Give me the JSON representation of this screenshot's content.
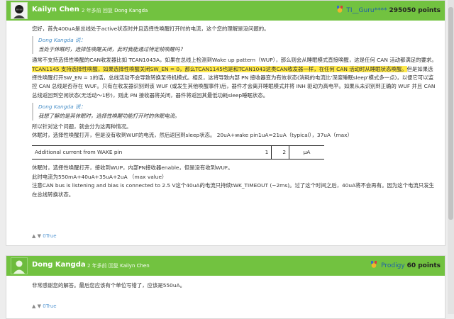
{
  "post1": {
    "author": "Kailyn Chen",
    "time": "2 年多前",
    "reply_label": "回复",
    "reply_to": "Dong Kangda",
    "rank_name": "TI__Guru****",
    "points": "295050 points",
    "lines": {
      "intro": "您好，首先400uA是总线处于active状态时并且选择性唤醒打开时的电流，这个您的理解是没问题的。",
      "q1_name": "Dong Kangda 说：",
      "q1_text": "当处于休眠时，选择性唤醒关闭，此时我能通过特定帧唤醒吗？",
      "p2a": "通常不支持选择性唤醒的CAN收发器比如 TCAN1043A，如果在总线上检测到Wake up pattern（WUP），那么则会从睡眠模式直接唤醒，这是任何 CAN 活动都满足的要求。",
      "p2b": "TCAN1145 支持选择性唤醒，如果选择性唤醒关闭SW_EN = 0，那么TCAN1145也是和TCAN1043这类CAN收发器一样，在任何 CAN 活动时从睡眠状态唤醒。",
      "p2c": "但是如果选择性唤醒打开SW_EN = 1的话，总线活动不会导致转换至待机模式。相反，这将导致内部 PN 接收器变为有效状态(消耗的电流比'深度睡眠sleep'模式多一点)，以便它可以监控 CAN 总线是否存在 WUF。只有在收发器识别到该 WUF (或发生其他唤醒事件)后，器件才会离开睡眠模式并将 INH 驱动为高电平。如果从未识别到正确的 WUF 并且 CAN 总线返回到空闲状态(无活动～1秒)，则此 PN 接收器将关闭，器件将返回其最低功耗sleep睡眠状态。",
      "q2_name": "Dong Kangda 说：",
      "q2_text": "我想了解的是其休眠时，选择性唤醒功能打开时的休眠电流。",
      "p3": "所以针对这个问题，就会分为这两种情况。",
      "p4": "休眠时，选择性唤醒打开，但是没有收到WUF的电流，然后返回到sleep状态。 20uA+wake pin1uA=21uA（typical），37uA（max）",
      "p5": "休眠时，选择性唤醒打开，接收到WUP，内部PN接收器enable，但是没有收到WUF。",
      "p6": "此时电流为550mA+40uA+35uA+2uA （max value）",
      "p7": "注意CAN bus is listening and bias is connected to 2.5 V这个40uA的电流只持续tWK_TIMEOUT (~2ms)。过了这个时间之后，40uA将不会再有。因为这个电流只发生在总线转换状态。"
    },
    "table": {
      "param": "Additional current from WAKE pin",
      "typ": "1",
      "max": "2",
      "unit": "μA"
    },
    "vote": "0True",
    "vote_arrows": "▲ ▼"
  },
  "post2": {
    "author": "Dong Kangda",
    "time": "2 年多前",
    "reply_label": "回复",
    "reply_to": "Kailyn Chen",
    "rank_name": "Prodigy",
    "points": "60 points",
    "line1": "非常感谢您的解答。最后您应该有个单位写错了，应该是550uA。",
    "vote": "0True",
    "vote_arrows": "▲ ▼"
  },
  "colors": {
    "header_green": "#72c240",
    "highlight": "#ffe94a",
    "quote_name": "#4a90c8"
  },
  "icons": [
    "medal-icon",
    "avatar-image"
  ]
}
